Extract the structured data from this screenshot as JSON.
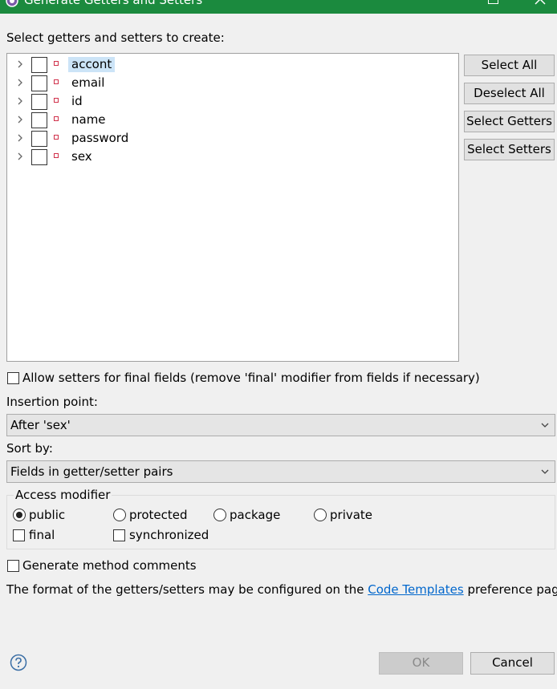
{
  "window": {
    "title": "Generate Getters and Setters",
    "icons": {
      "app": "gear-icon",
      "maximize": "maximize-icon",
      "close": "close-icon"
    }
  },
  "instruction": "Select getters and setters to create:",
  "fields": [
    {
      "name": "accont",
      "checked": false,
      "selected": true
    },
    {
      "name": "email",
      "checked": false,
      "selected": false
    },
    {
      "name": "id",
      "checked": false,
      "selected": false
    },
    {
      "name": "name",
      "checked": false,
      "selected": false
    },
    {
      "name": "password",
      "checked": false,
      "selected": false
    },
    {
      "name": "sex",
      "checked": false,
      "selected": false
    }
  ],
  "side_buttons": {
    "select_all": "Select All",
    "deselect_all": "Deselect All",
    "select_getters": "Select Getters",
    "select_setters": "Select Setters"
  },
  "allow_setters": {
    "label": "Allow setters for final fields (remove 'final' modifier from fields if necessary)",
    "checked": false
  },
  "insertion": {
    "label": "Insertion point:",
    "value": "After 'sex'"
  },
  "sort": {
    "label": "Sort by:",
    "value": "Fields in getter/setter pairs"
  },
  "access": {
    "title": "Access modifier",
    "options": [
      "public",
      "protected",
      "package",
      "private"
    ],
    "selected": "public",
    "final_label": "final",
    "synchronized_label": "synchronized"
  },
  "comments": {
    "label": "Generate method comments",
    "checked": false
  },
  "footer_text": {
    "before": "The format of the getters/setters may be configured on the ",
    "link": "Code Templates",
    "after": " preference page."
  },
  "buttons": {
    "ok": "OK",
    "cancel": "Cancel"
  },
  "colors": {
    "titlebar": "#1b8a3e",
    "selection": "#cce4f7",
    "link": "#0066cc",
    "field_icon": "#d0304a"
  }
}
